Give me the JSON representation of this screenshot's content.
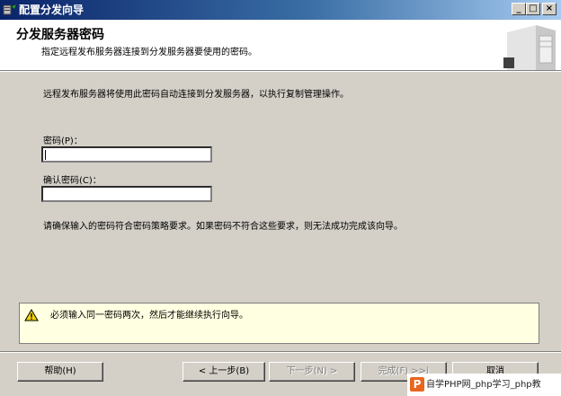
{
  "window": {
    "title": "配置分发向导",
    "minimize": "_",
    "maximize": "□",
    "close": "×"
  },
  "header": {
    "title": "分发服务器密码",
    "subtitle": "指定远程发布服务器连接到分发服务器要使用的密码。"
  },
  "body": {
    "intro": "远程发布服务器将使用此密码自动连接到分发服务器，以执行复制管理操作。",
    "password_label": "密码(P)：",
    "confirm_label": "确认密码(C)：",
    "password_value": "",
    "confirm_value": "",
    "note": "请确保输入的密码符合密码策略要求。如果密码不符合这些要求，则无法成功完成该向导。"
  },
  "message": {
    "text": "必须输入同一密码两次，然后才能继续执行向导。",
    "icon": "warning-icon"
  },
  "buttons": {
    "help": "帮助(H)",
    "back": "< 上一步(B)",
    "next": "下一步(N) >",
    "finish": "完成(F) >>|",
    "cancel": "取消"
  },
  "watermark": {
    "logo": "P",
    "text": "自学PHP网_php学习_php教"
  },
  "colors": {
    "titlebar_start": "#0a246a",
    "titlebar_end": "#a6caf0",
    "dialog": "#d4d0c8",
    "message_bg": "#ffffe1"
  }
}
